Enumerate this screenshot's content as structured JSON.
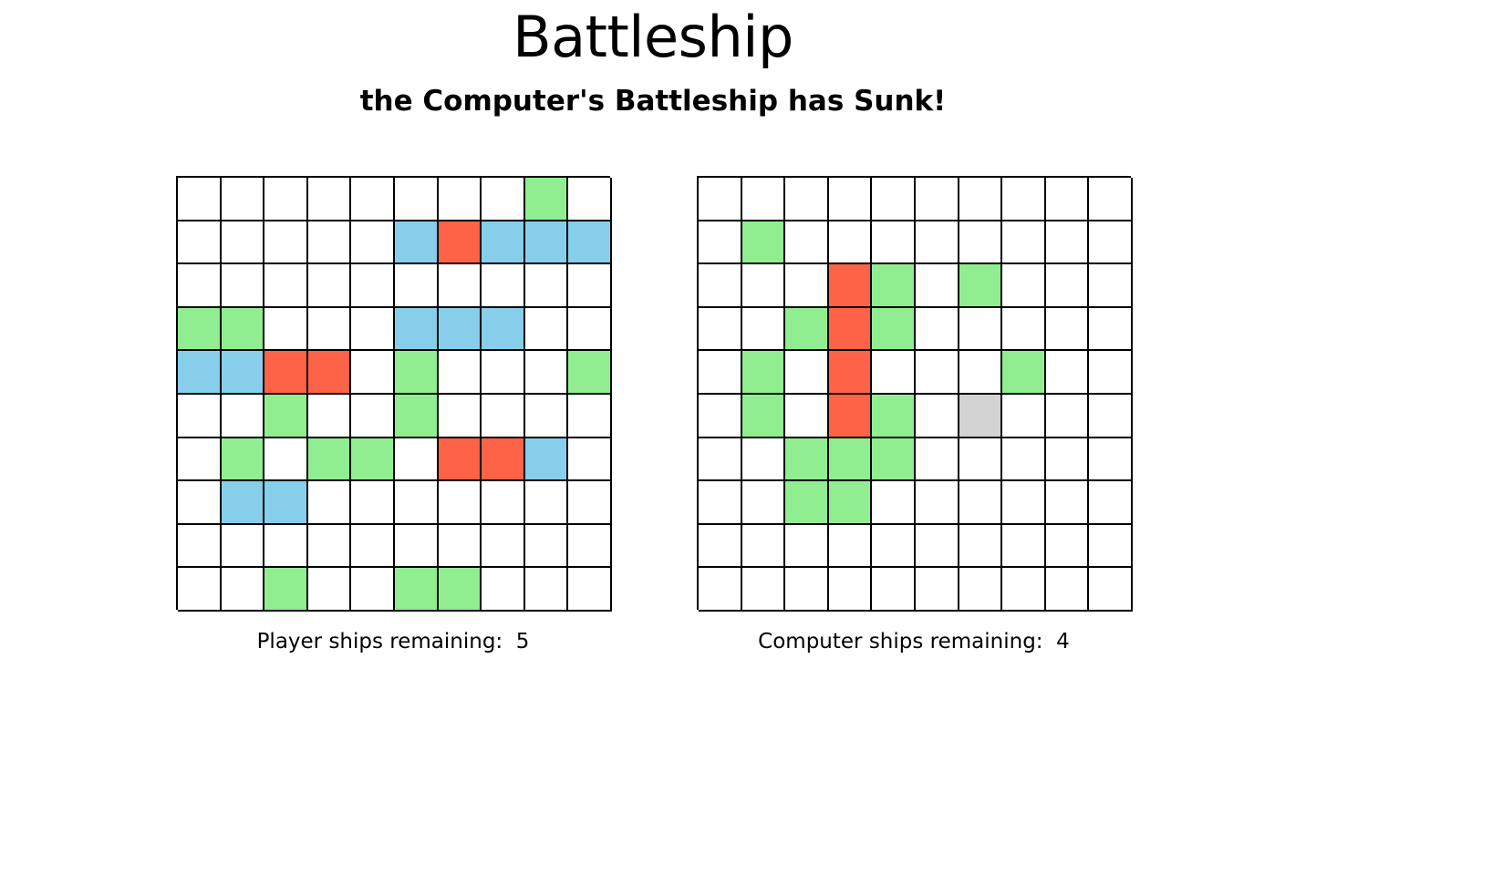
{
  "title": "Battleship",
  "status_message": "the Computer's Battleship has Sunk!",
  "colors": {
    "empty": "#ffffff",
    "ship": "#87ceeb",
    "hit": "#ff6347",
    "miss": "#90ee90",
    "pending": "#d3d3d3"
  },
  "player": {
    "remaining_label": "Player ships remaining:",
    "remaining_count": "5",
    "grid": [
      [
        "empty",
        "empty",
        "empty",
        "empty",
        "empty",
        "empty",
        "empty",
        "empty",
        "miss",
        "empty"
      ],
      [
        "empty",
        "empty",
        "empty",
        "empty",
        "empty",
        "ship",
        "hit",
        "ship",
        "ship",
        "ship"
      ],
      [
        "empty",
        "empty",
        "empty",
        "empty",
        "empty",
        "empty",
        "empty",
        "empty",
        "empty",
        "empty"
      ],
      [
        "miss",
        "miss",
        "empty",
        "empty",
        "empty",
        "ship",
        "ship",
        "ship",
        "empty",
        "empty"
      ],
      [
        "ship",
        "ship",
        "hit",
        "hit",
        "empty",
        "miss",
        "empty",
        "empty",
        "empty",
        "miss"
      ],
      [
        "empty",
        "empty",
        "miss",
        "empty",
        "empty",
        "miss",
        "empty",
        "empty",
        "empty",
        "empty"
      ],
      [
        "empty",
        "miss",
        "empty",
        "miss",
        "miss",
        "empty",
        "hit",
        "hit",
        "ship",
        "empty"
      ],
      [
        "empty",
        "ship",
        "ship",
        "empty",
        "empty",
        "empty",
        "empty",
        "empty",
        "empty",
        "empty"
      ],
      [
        "empty",
        "empty",
        "empty",
        "empty",
        "empty",
        "empty",
        "empty",
        "empty",
        "empty",
        "empty"
      ],
      [
        "empty",
        "empty",
        "miss",
        "empty",
        "empty",
        "miss",
        "miss",
        "empty",
        "empty",
        "empty"
      ]
    ]
  },
  "computer": {
    "remaining_label": "Computer ships remaining:",
    "remaining_count": "4",
    "grid": [
      [
        "empty",
        "empty",
        "empty",
        "empty",
        "empty",
        "empty",
        "empty",
        "empty",
        "empty",
        "empty"
      ],
      [
        "empty",
        "miss",
        "empty",
        "empty",
        "empty",
        "empty",
        "empty",
        "empty",
        "empty",
        "empty"
      ],
      [
        "empty",
        "empty",
        "empty",
        "hit",
        "miss",
        "empty",
        "miss",
        "empty",
        "empty",
        "empty"
      ],
      [
        "empty",
        "empty",
        "miss",
        "hit",
        "miss",
        "empty",
        "empty",
        "empty",
        "empty",
        "empty"
      ],
      [
        "empty",
        "miss",
        "empty",
        "hit",
        "empty",
        "empty",
        "empty",
        "miss",
        "empty",
        "empty"
      ],
      [
        "empty",
        "miss",
        "empty",
        "hit",
        "miss",
        "empty",
        "pending",
        "empty",
        "empty",
        "empty"
      ],
      [
        "empty",
        "empty",
        "miss",
        "miss",
        "miss",
        "empty",
        "empty",
        "empty",
        "empty",
        "empty"
      ],
      [
        "empty",
        "empty",
        "miss",
        "miss",
        "empty",
        "empty",
        "empty",
        "empty",
        "empty",
        "empty"
      ],
      [
        "empty",
        "empty",
        "empty",
        "empty",
        "empty",
        "empty",
        "empty",
        "empty",
        "empty",
        "empty"
      ],
      [
        "empty",
        "empty",
        "empty",
        "empty",
        "empty",
        "empty",
        "empty",
        "empty",
        "empty",
        "empty"
      ]
    ]
  }
}
